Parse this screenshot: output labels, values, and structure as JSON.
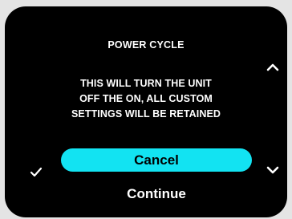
{
  "dialog": {
    "title": "POWER CYCLE",
    "message_lines": [
      "THIS WILL TURN THE UNIT",
      "OFF THE ON, ALL CUSTOM",
      "SETTINGS WILL BE RETAINED"
    ]
  },
  "options": {
    "cancel_label": "Cancel",
    "continue_label": "Continue",
    "selected": "Cancel"
  },
  "icons": {
    "scroll_up": "chevron-up-icon",
    "scroll_down": "chevron-down-icon",
    "confirm": "check-icon"
  },
  "colors": {
    "screen_background": "#000000",
    "text": "#ffffff",
    "selection_highlight": "#12e3f2",
    "selected_text": "#000000"
  }
}
